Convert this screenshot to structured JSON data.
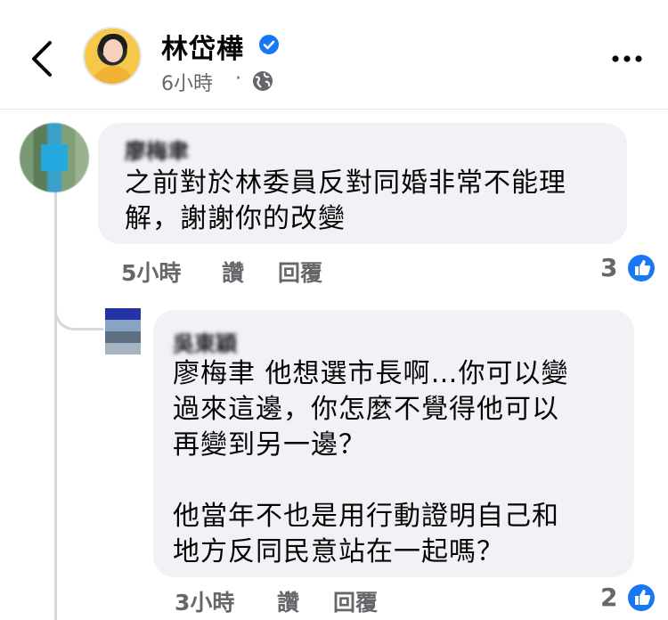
{
  "header": {
    "back_icon": "chevron-left-icon",
    "author_name": "林岱樺",
    "verified_icon": "verified-badge-icon",
    "time": "6小時",
    "separator": "·",
    "audience_icon": "globe-icon",
    "more_icon": "more-horizontal-icon"
  },
  "comments": [
    {
      "author": "廖梅聿",
      "text": "之前對於林委員反對同婚非常不能理\n解，謝謝你的改變",
      "time": "5小時",
      "like_label": "讚",
      "reply_label": "回覆",
      "reaction_count": "3"
    },
    {
      "author": "吳東穎",
      "text": "廖梅聿 他想選市長啊…你可以變\n過來這邊，你怎麼不覺得他可以\n再變到另一邊？\n\n他當年不也是用行動證明自己和\n地方反同民意站在一起嗎？",
      "time": "3小時",
      "like_label": "讚",
      "reply_label": "回覆",
      "reaction_count": "2"
    }
  ],
  "colors": {
    "accent": "#1877f2",
    "bubble": "#f0f2f5",
    "secondary_text": "#65676b"
  }
}
